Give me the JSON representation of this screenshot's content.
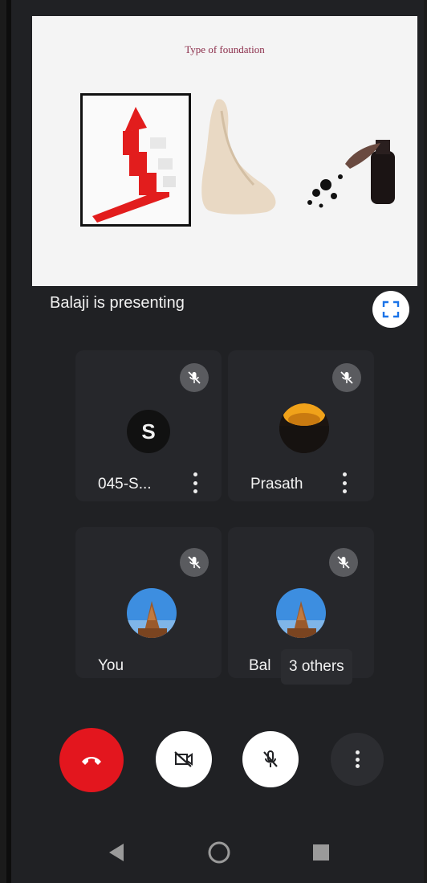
{
  "slide": {
    "title": "Type of foundation"
  },
  "presentation": {
    "status_text": "Balaji is presenting"
  },
  "participants": [
    {
      "name": "045-S...",
      "avatar_letter": "S"
    },
    {
      "name": "Prasath"
    },
    {
      "name": "You"
    },
    {
      "name": "Bal"
    }
  ],
  "others_chip": {
    "label": "3 others"
  },
  "controls": {
    "end_call_color": "#e3161e",
    "button_color": "#ffffff"
  },
  "icons": {
    "fullscreen": "fullscreen-icon",
    "mic_off": "mic-off-icon",
    "camera_off": "camera-off-icon",
    "end_call": "phone-hangup-icon",
    "more": "more-vertical-icon",
    "nav_back": "back-triangle-icon",
    "nav_home": "home-circle-icon",
    "nav_recents": "recents-square-icon"
  }
}
